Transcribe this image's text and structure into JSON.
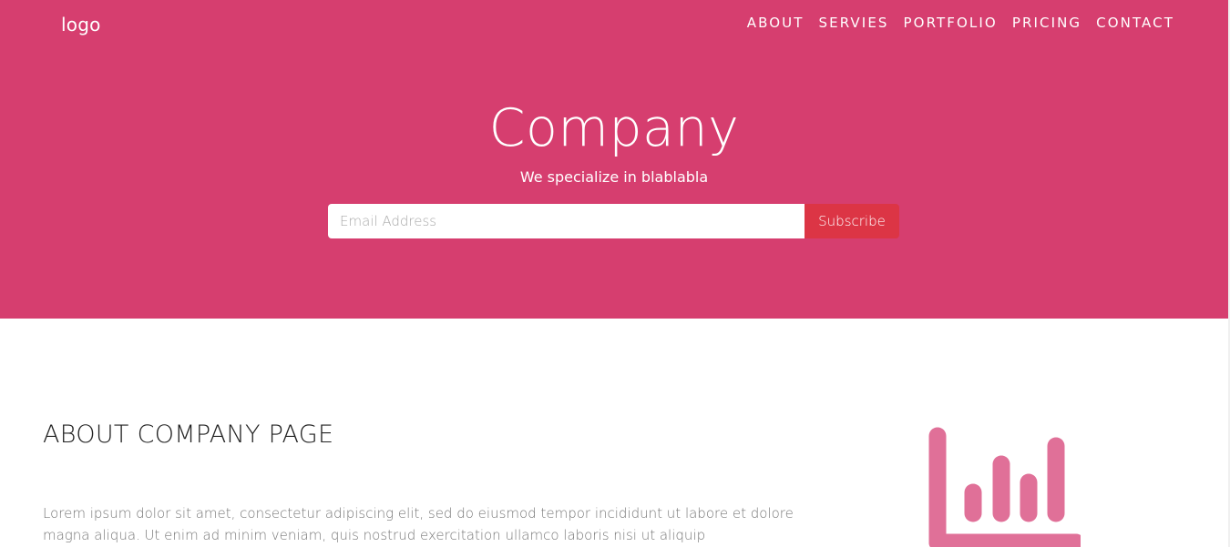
{
  "header": {
    "logo": "logo",
    "nav": [
      "ABOUT",
      "SERVIES",
      "PORTFOLIO",
      "PRICING",
      "CONTACT"
    ]
  },
  "hero": {
    "title": "Company",
    "subtitle": "We specialize in blablabla",
    "email_placeholder": "Email Address",
    "subscribe_label": "Subscribe"
  },
  "about": {
    "title": "ABOUT COMPANY PAGE",
    "text": "Lorem ipsum dolor sit amet, consectetur adipiscing elit, sed do eiusmod tempor incididunt ut labore et dolore magna aliqua. Ut enim ad minim veniam, quis nostrud exercitation ullamco laboris nisi ut aliquip"
  },
  "icons": {
    "about_icon": "bar-chart-icon"
  },
  "colors": {
    "hero_bg": "#d63e6f",
    "subscribe_bg": "#dc3545",
    "icon_color": "#e07098"
  }
}
